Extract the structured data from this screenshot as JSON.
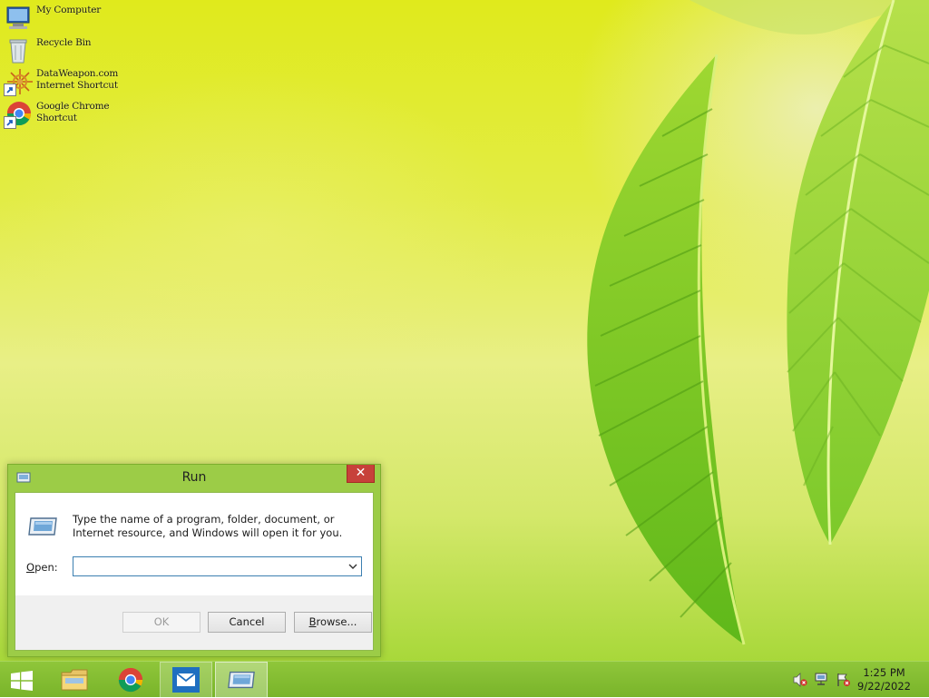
{
  "desktop": {
    "icons": [
      {
        "label": "My Computer",
        "icon": "computer-icon"
      },
      {
        "label": "Recycle Bin",
        "icon": "recycle-bin-icon"
      },
      {
        "label": "DataWeapon.com Internet Shortcut",
        "line1": "DataWeapon.com",
        "line2": "Internet Shortcut",
        "icon": "internet-shortcut-icon"
      },
      {
        "label": "Google Chrome Shortcut",
        "line1": "Google Chrome",
        "line2": "Shortcut",
        "icon": "chrome-icon"
      }
    ]
  },
  "run_dialog": {
    "title": "Run",
    "close_glyph": "✕",
    "description": "Type the name of a program, folder, document, or Internet resource, and Windows will open it for you.",
    "open_label_prefix": "",
    "open_label_accel": "O",
    "open_label_rest": "pen:",
    "open_value": "",
    "ok_label": "OK",
    "cancel_label": "Cancel",
    "browse_label_accel": "B",
    "browse_label_rest": "rowse...",
    "ok_enabled": false
  },
  "taskbar": {
    "buttons": [
      {
        "name": "start",
        "icon": "windows-logo-icon"
      },
      {
        "name": "file-explorer",
        "icon": "folder-icon"
      },
      {
        "name": "google-chrome",
        "icon": "chrome-icon"
      },
      {
        "name": "mail",
        "icon": "mail-icon"
      },
      {
        "name": "run",
        "icon": "run-icon",
        "active": true
      }
    ],
    "tray": {
      "icons": [
        "volume-muted-icon",
        "network-icon",
        "action-center-flag-icon"
      ],
      "time": "1:25 PM",
      "date": "9/22/2022"
    }
  },
  "colors": {
    "taskbar": "#86bf34",
    "dialog_frame": "#9ccc47",
    "close_button": "#c7413a",
    "combo_border": "#3c7fb1"
  }
}
